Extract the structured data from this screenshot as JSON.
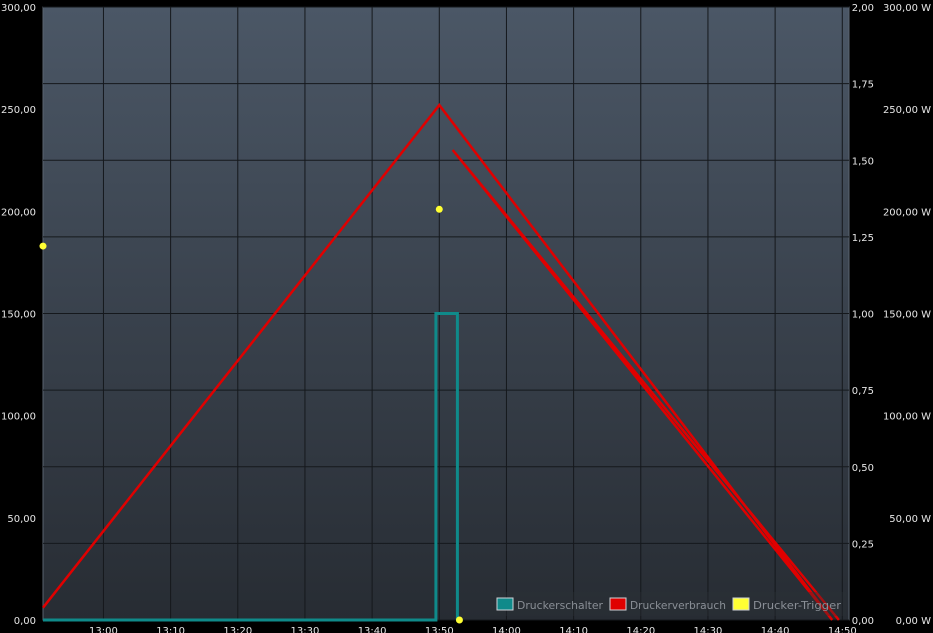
{
  "chart_data": {
    "type": "line",
    "title": "",
    "xlabel": "",
    "ylabel": "",
    "x_ticks": [
      "13:00",
      "13:10",
      "13:20",
      "13:30",
      "13:40",
      "13:50",
      "14:00",
      "14:10",
      "14:20",
      "14:30",
      "14:40",
      "14:50"
    ],
    "x_range": [
      "12:51",
      "14:51"
    ],
    "y_left": {
      "range": [
        0,
        300
      ],
      "ticks": [
        "0,00",
        "50,00",
        "100,00",
        "150,00",
        "200,00",
        "250,00",
        "300,00"
      ]
    },
    "y_right_inner": {
      "range": [
        0,
        2
      ],
      "ticks": [
        "0,00",
        "0,25",
        "0,50",
        "0,75",
        "1,00",
        "1,25",
        "1,50",
        "1,75",
        "2,00"
      ]
    },
    "y_right_outer": {
      "range": [
        0,
        300
      ],
      "ticks": [
        "0,00 W",
        "50,00 W",
        "100,00 W",
        "150,00 W",
        "200,00 W",
        "250,00 W",
        "300,00 W"
      ]
    },
    "grid": true,
    "legend_position": "bottom-right",
    "series": [
      {
        "name": "Druckerschalter",
        "type": "step",
        "axis": "right",
        "color": "#0f8a8a",
        "points": [
          [
            "12:51",
            0
          ],
          [
            "13:49.5",
            0
          ],
          [
            "13:49.5",
            1
          ],
          [
            "13:52.7",
            1
          ],
          [
            "13:52.7",
            0
          ]
        ]
      },
      {
        "name": "Druckerverbrauch",
        "type": "line",
        "axis": "left",
        "color": "#e00000",
        "points": [
          [
            "12:51",
            6
          ],
          [
            "13:50",
            252
          ],
          [
            "14:48.5",
            0
          ],
          [
            "13:52",
            230
          ],
          [
            "14:49.5",
            0
          ]
        ]
      },
      {
        "name": "Drucker-Trigger",
        "type": "scatter",
        "axis": "right",
        "color": "#ffff33",
        "points": [
          [
            "12:51",
            1.22
          ],
          [
            "13:50",
            1.34
          ],
          [
            "13:53",
            0
          ]
        ]
      }
    ]
  }
}
